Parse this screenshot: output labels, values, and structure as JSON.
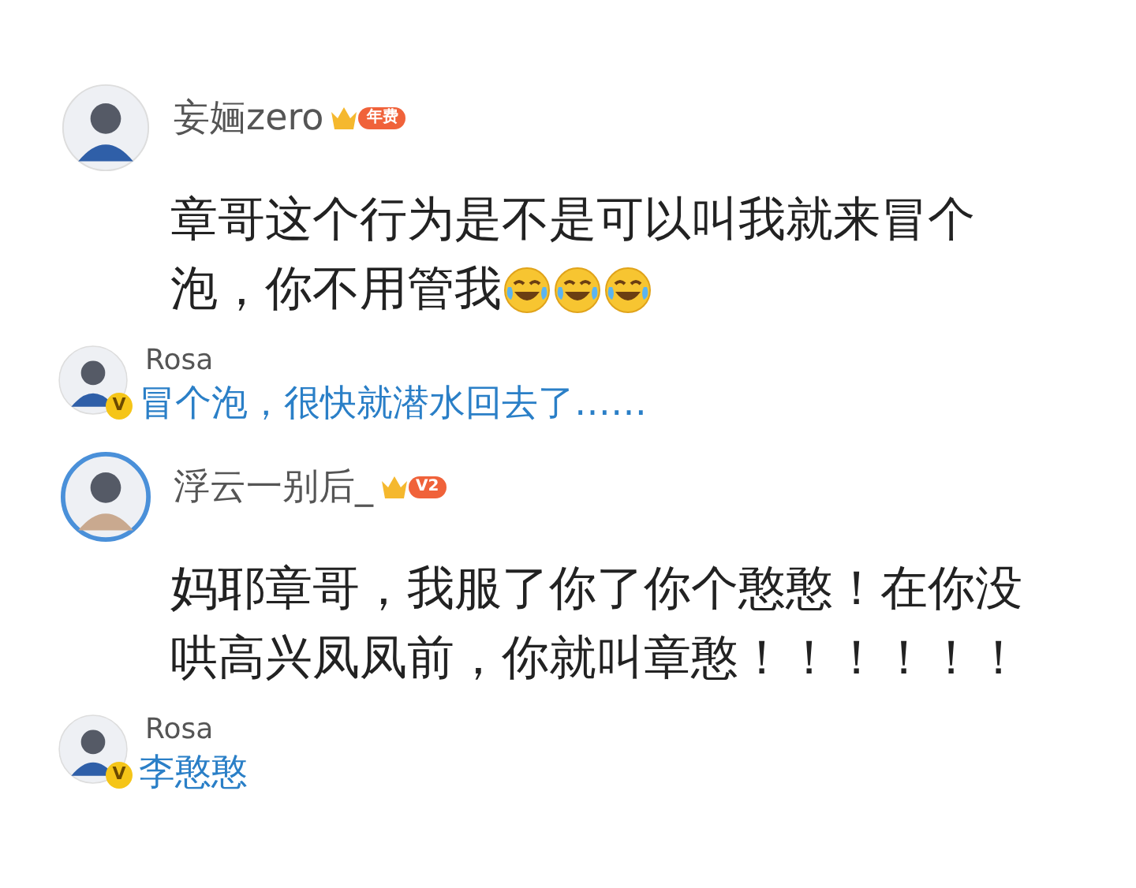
{
  "comments": [
    {
      "author": "妄婳zero",
      "badge": "年费",
      "body": [
        "章哥这个行为是不是可以叫我就来冒个",
        "泡，你不用管我"
      ],
      "emojis": [
        {
          "kind": "laugh"
        },
        {
          "kind": "laugh"
        },
        {
          "kind": "laugh"
        }
      ],
      "reply": {
        "author": "Rosa",
        "verified": "V",
        "text": "冒个泡，很快就潜水回去了……"
      }
    },
    {
      "author": "浮云一别后_",
      "badge": "V2",
      "body": [
        "妈耶章哥，我服了你了你个憨憨！在你没",
        "哄高兴凤凤前，你就叫章憨！！！！！！"
      ],
      "reply": {
        "author": "Rosa",
        "verified": "V",
        "text": "李憨憨"
      }
    }
  ]
}
